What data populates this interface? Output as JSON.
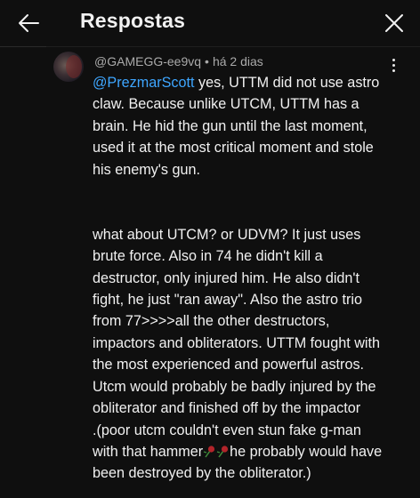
{
  "header": {
    "title": "Respostas"
  },
  "comment": {
    "author": "@GAMEGG-ee9vq",
    "separator": "•",
    "time": "há 2 dias",
    "mention": "@PrezmarScott",
    "para1_rest": " yes, UTTM did not use astro claw. Because unlike UTCM, UTTM has a brain. He hid the gun until the last moment, used it at the most critical moment and stole his enemy's gun.",
    "para2": "what about UTCM? or UDVM? It just uses brute force. Also in 74 he didn't kill a destructor, only injured him. He also didn't fight, he just \"ran away\". Also the astro trio from 77>>>>all the other destructors, impactors and obliterators. UTTM fought with the most experienced and powerful astros. Utcm would probably be badly injured by the obliterator and finished off by the impactor",
    "para3_a": ".(poor utcm couldn't even stun fake g-man with that hammer",
    "para3_b": "he probably would have been destroyed by the obliterator.)"
  },
  "icons": {
    "back": "arrow-left-icon",
    "close": "close-icon",
    "more": "more-vertical-icon",
    "emoji": "wilted-rose-emoji"
  },
  "colors": {
    "background": "#0f0f0f",
    "text": "#f1f1f1",
    "meta": "#aaaaaa",
    "mention": "#3ea6ff"
  }
}
